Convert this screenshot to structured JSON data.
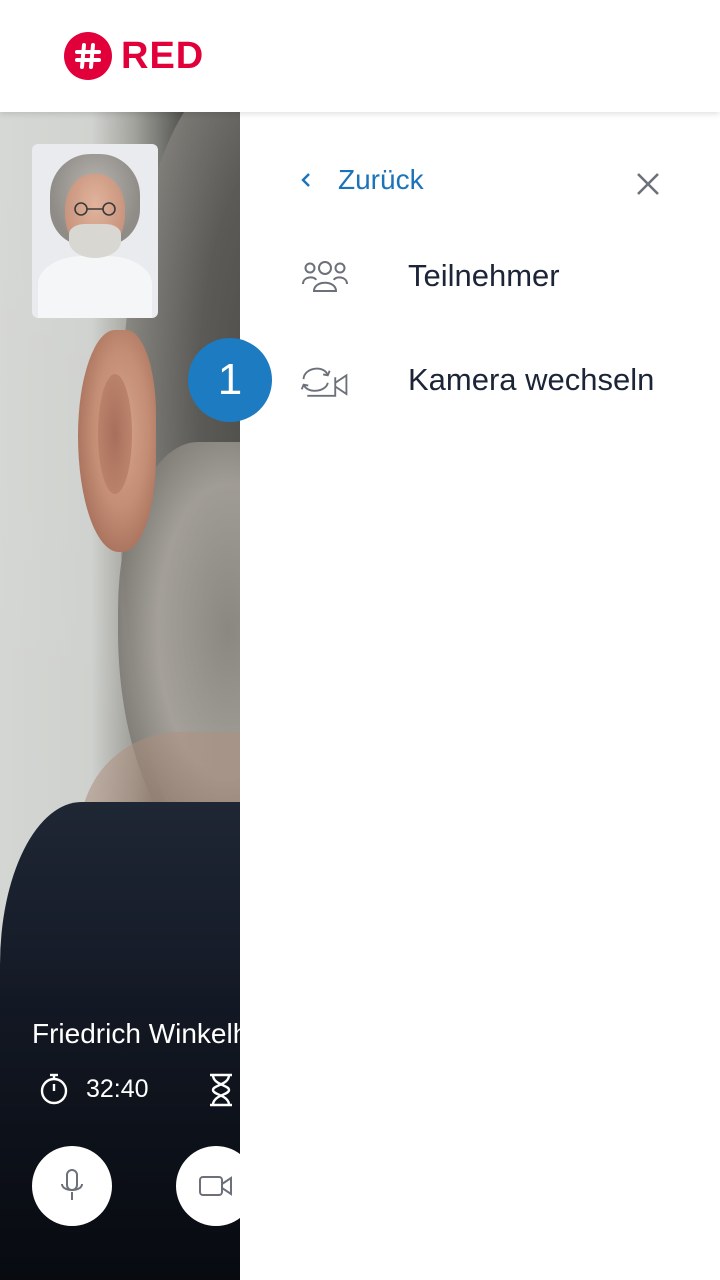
{
  "header": {
    "logo_text": "RED",
    "brand_color": "#e2003b"
  },
  "call": {
    "caller_name": "Friedrich Winkelh",
    "elapsed_time": "32:40",
    "icons": {
      "timer": "stopwatch-icon",
      "remaining": "hourglass-icon",
      "mic": "microphone-icon",
      "camera": "video-camera-icon"
    }
  },
  "panel": {
    "back_label": "Zurück",
    "items": [
      {
        "label": "Teilnehmer",
        "icon": "participants-icon"
      },
      {
        "label": "Kamera wechseln",
        "icon": "switch-camera-icon"
      }
    ],
    "accent_color": "#1a73bb"
  },
  "step_badge": {
    "number": "1"
  }
}
